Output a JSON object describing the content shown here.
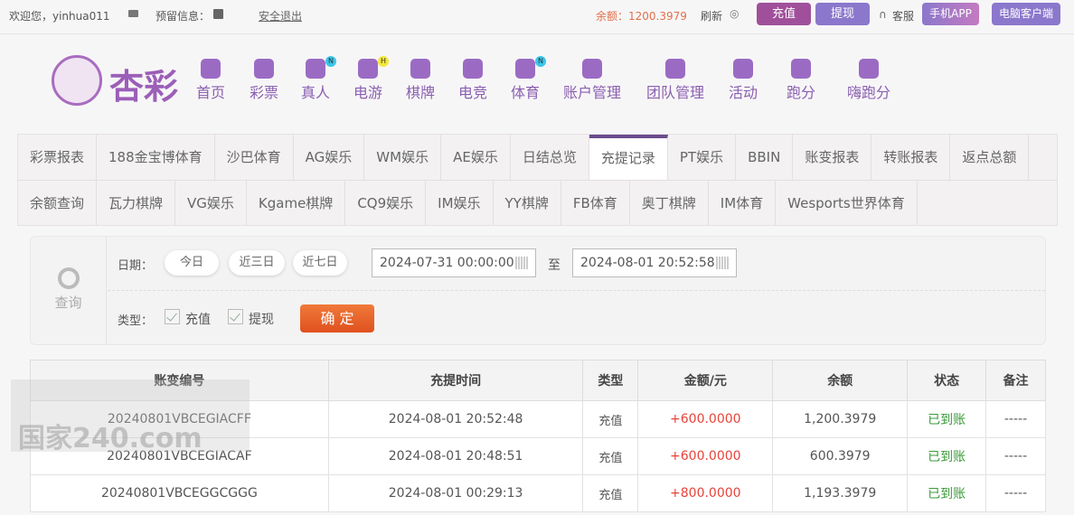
{
  "topbar": {
    "welcome": "欢迎您，yinhua011",
    "reserved_info": "预留信息：",
    "logout": "安全退出",
    "balance": "余额：1200.3979",
    "refresh": "刷新",
    "deposit": "充值",
    "withdraw": "提现",
    "service": "客服",
    "mobile_app": "手机APP",
    "pc_client": "电脑客户端"
  },
  "logo": {
    "text": "杏彩"
  },
  "nav": [
    {
      "label": "首页"
    },
    {
      "label": "彩票"
    },
    {
      "label": "真人",
      "badge": "N"
    },
    {
      "label": "电游",
      "badge": "H"
    },
    {
      "label": "棋牌"
    },
    {
      "label": "电竞"
    },
    {
      "label": "体育",
      "badge": "N"
    },
    {
      "label": "账户管理"
    },
    {
      "label": "团队管理"
    },
    {
      "label": "活动"
    },
    {
      "label": "跑分"
    },
    {
      "label": "嗨跑分"
    }
  ],
  "tabs_row1": [
    "彩票报表",
    "188金宝博体育",
    "沙巴体育",
    "AG娱乐",
    "WM娱乐",
    "AE娱乐",
    "日结总览",
    "充提记录",
    "PT娱乐",
    "BBIN",
    "账变报表",
    "转账报表",
    "返点总额"
  ],
  "tabs_row2": [
    "余额查询",
    "瓦力棋牌",
    "VG娱乐",
    "Kgame棋牌",
    "CQ9娱乐",
    "IM娱乐",
    "YY棋牌",
    "FB体育",
    "奥丁棋牌",
    "IM体育",
    "Wesports世界体育"
  ],
  "active_tab": "充提记录",
  "filter": {
    "query": "查询",
    "date_label": "日期：",
    "today": "今日",
    "last3": "近三日",
    "last7": "近七日",
    "start": "2024-07-31 00:00:00",
    "to": "至",
    "end": "2024-08-01 20:52:58",
    "type_label": "类型：",
    "type_deposit": "充值",
    "type_withdraw": "提现",
    "confirm": "确 定"
  },
  "table": {
    "headers": [
      "账变编号",
      "充提时间",
      "类型",
      "金额/元",
      "余额",
      "状态",
      "备注"
    ],
    "rows": [
      [
        "20240801VBCEGIACFF",
        "2024-08-01 20:52:48",
        "充值",
        "+600.0000",
        "1,200.3979",
        "已到账",
        "-----"
      ],
      [
        "20240801VBCEGIACAF",
        "2024-08-01 20:48:51",
        "充值",
        "+600.0000",
        "600.3979",
        "已到账",
        "-----"
      ],
      [
        "20240801VBCEGGCGGG",
        "2024-08-01 00:29:13",
        "充值",
        "+800.0000",
        "1,193.3979",
        "已到账",
        "-----"
      ]
    ]
  },
  "watermark": "国家240.com",
  "colors": {
    "brand": "#8a5fb0",
    "deposit": "#a0509a",
    "withdraw": "#8b78cc",
    "confirm": "#e85a28",
    "amount": "#e8423a",
    "status": "#3a9a3a"
  }
}
